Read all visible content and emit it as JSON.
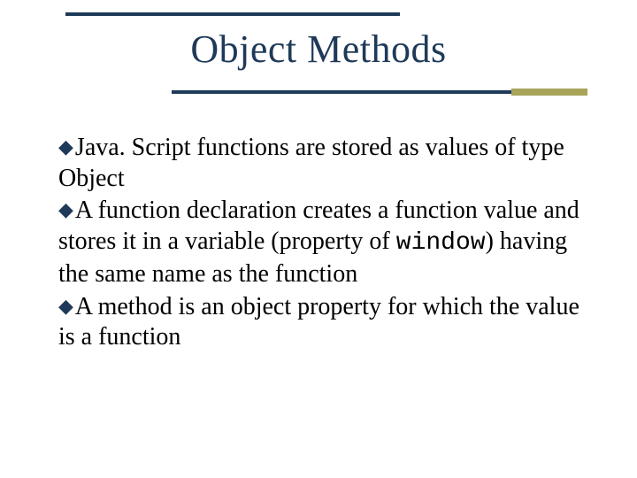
{
  "title": "Object Methods",
  "bullets": [
    {
      "text_a": "Java. Script functions are stored as values of type Object"
    },
    {
      "text_a": "A function declaration creates a function value and stores it in a variable (property of ",
      "code": "window",
      "text_b": ") having the same name as the function"
    },
    {
      "text_a": "A method is an object property for which the value is a function"
    }
  ]
}
